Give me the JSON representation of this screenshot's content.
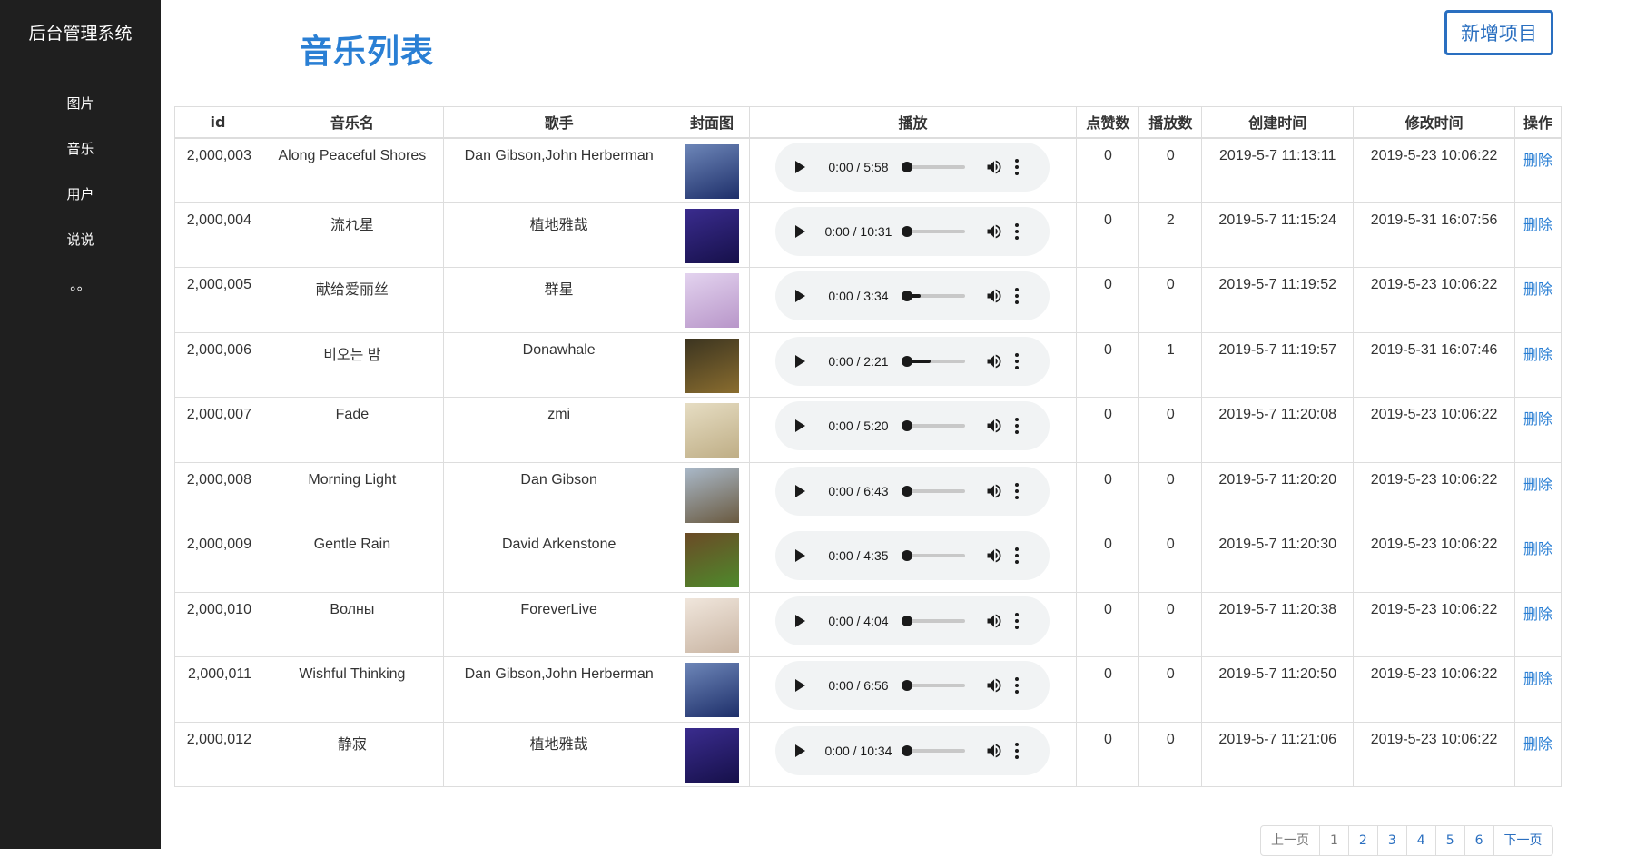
{
  "sidebar": {
    "brand": "后台管理系统",
    "items": [
      {
        "label": "图片"
      },
      {
        "label": "音乐"
      },
      {
        "label": "用户"
      },
      {
        "label": "说说"
      },
      {
        "label": "。。"
      }
    ]
  },
  "header": {
    "title": "音乐列表",
    "add_button": "新增项目"
  },
  "table": {
    "columns": [
      "id",
      "音乐名",
      "歌手",
      "封面图",
      "播放",
      "点赞数",
      "播放数",
      "创建时间",
      "修改时间",
      "操作"
    ],
    "rows": [
      {
        "id": "2,000,003",
        "name": "Along Peaceful Shores",
        "singer": "Dan Gibson,John Herberman",
        "time": "0:00 / 5:58",
        "progress": 0,
        "likes": "0",
        "plays": "0",
        "created": "2019-5-7 11:13:11",
        "modified": "2019-5-23 10:06:22",
        "action": "删除",
        "cover_colors": [
          "#6d86b8",
          "#1e2f6a"
        ]
      },
      {
        "id": "2,000,004",
        "name": "流れ星",
        "singer": "植地雅哉",
        "time": "0:00 / 10:31",
        "progress": 0,
        "likes": "0",
        "plays": "2",
        "created": "2019-5-7 11:15:24",
        "modified": "2019-5-31 16:07:56",
        "action": "删除",
        "cover_colors": [
          "#3a2c8e",
          "#16104a"
        ]
      },
      {
        "id": "2,000,005",
        "name": "献给爱丽丝",
        "singer": "群星",
        "time": "0:00 / 3:34",
        "progress": 0.3,
        "likes": "0",
        "plays": "0",
        "created": "2019-5-7 11:19:52",
        "modified": "2019-5-23 10:06:22",
        "action": "删除",
        "cover_colors": [
          "#e3d3ef",
          "#b896c9"
        ]
      },
      {
        "id": "2,000,006",
        "name": "비오는 밤",
        "singer": "Donawhale",
        "time": "0:00 / 2:21",
        "progress": 0.45,
        "likes": "0",
        "plays": "1",
        "created": "2019-5-7 11:19:57",
        "modified": "2019-5-31 16:07:46",
        "action": "删除",
        "cover_colors": [
          "#3b3420",
          "#8a6d2f"
        ]
      },
      {
        "id": "2,000,007",
        "name": "Fade",
        "singer": "zmi",
        "time": "0:00 / 5:20",
        "progress": 0,
        "likes": "0",
        "plays": "0",
        "created": "2019-5-7 11:20:08",
        "modified": "2019-5-23 10:06:22",
        "action": "删除",
        "cover_colors": [
          "#e6ddc3",
          "#bfae86"
        ]
      },
      {
        "id": "2,000,008",
        "name": "Morning Light",
        "singer": "Dan Gibson",
        "time": "0:00 / 6:43",
        "progress": 0,
        "likes": "0",
        "plays": "0",
        "created": "2019-5-7 11:20:20",
        "modified": "2019-5-23 10:06:22",
        "action": "删除",
        "cover_colors": [
          "#a9b8c8",
          "#6a5a40"
        ]
      },
      {
        "id": "2,000,009",
        "name": "Gentle Rain",
        "singer": "David Arkenstone",
        "time": "0:00 / 4:35",
        "progress": 0,
        "likes": "0",
        "plays": "0",
        "created": "2019-5-7 11:20:30",
        "modified": "2019-5-23 10:06:22",
        "action": "删除",
        "cover_colors": [
          "#6b4a26",
          "#4e8a2c"
        ]
      },
      {
        "id": "2,000,010",
        "name": "Волны",
        "singer": "ForeverLive",
        "time": "0:00 / 4:04",
        "progress": 0,
        "likes": "0",
        "plays": "0",
        "created": "2019-5-7 11:20:38",
        "modified": "2019-5-23 10:06:22",
        "action": "删除",
        "cover_colors": [
          "#f0e6dc",
          "#c9b5a3"
        ]
      },
      {
        "id": "2,000,011",
        "name": "Wishful Thinking",
        "singer": "Dan Gibson,John Herberman",
        "time": "0:00 / 6:56",
        "progress": 0,
        "likes": "0",
        "plays": "0",
        "created": "2019-5-7 11:20:50",
        "modified": "2019-5-23 10:06:22",
        "action": "删除",
        "cover_colors": [
          "#6d86b8",
          "#1e2f6a"
        ]
      },
      {
        "id": "2,000,012",
        "name": "静寂",
        "singer": "植地雅哉",
        "time": "0:00 / 10:34",
        "progress": 0,
        "likes": "0",
        "plays": "0",
        "created": "2019-5-7 11:21:06",
        "modified": "2019-5-23 10:06:22",
        "action": "删除",
        "cover_colors": [
          "#3a2c8e",
          "#16104a"
        ]
      }
    ]
  },
  "pagination": {
    "prev": "上一页",
    "pages": [
      "1",
      "2",
      "3",
      "4",
      "5",
      "6"
    ],
    "current": "1",
    "next": "下一页"
  },
  "colors": {
    "accent": "#2a7fd4",
    "sidebar_bg": "#1f1f1f"
  }
}
